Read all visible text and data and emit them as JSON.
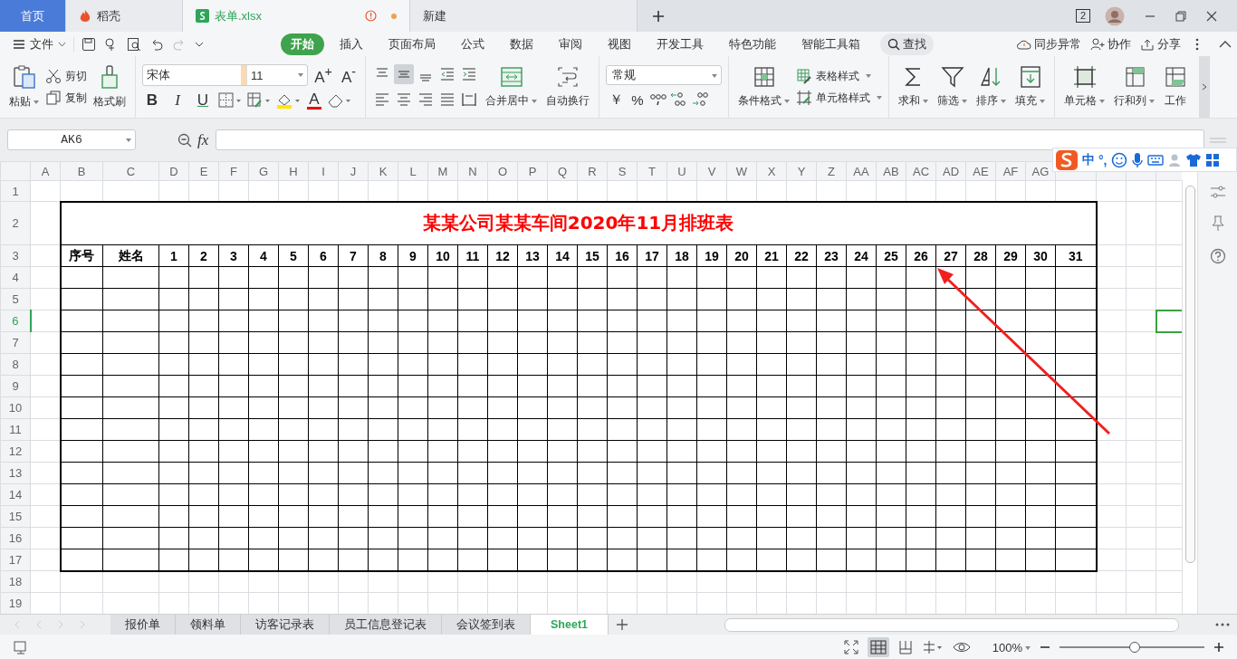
{
  "app_tabs": [
    {
      "kind": "home",
      "label": "首页",
      "selected": false,
      "unsaved": false
    },
    {
      "kind": "docer",
      "label": "稻壳",
      "selected": false,
      "unsaved": false
    },
    {
      "kind": "sheet",
      "label": "表单.xlsx",
      "selected": true,
      "unsaved": true
    },
    {
      "kind": "blank",
      "label": "新建",
      "selected": false,
      "unsaved": false
    }
  ],
  "window_count": "2",
  "menu": {
    "file": "文件",
    "tabs": [
      {
        "label": "开始",
        "selected": true
      },
      {
        "label": "插入",
        "selected": false
      },
      {
        "label": "页面布局",
        "selected": false
      },
      {
        "label": "公式",
        "selected": false
      },
      {
        "label": "数据",
        "selected": false
      },
      {
        "label": "审阅",
        "selected": false
      },
      {
        "label": "视图",
        "selected": false
      },
      {
        "label": "开发工具",
        "selected": false
      },
      {
        "label": "特色功能",
        "selected": false
      },
      {
        "label": "智能工具箱",
        "selected": false
      }
    ],
    "search": "查找",
    "actions": [
      {
        "kind": "sync",
        "label": "同步异常"
      },
      {
        "kind": "collab",
        "label": "协作"
      },
      {
        "kind": "share",
        "label": "分享"
      }
    ]
  },
  "ribbon": {
    "paste": "粘贴",
    "cut": "剪切",
    "copy": "复制",
    "format_painter": "格式刷",
    "font_name": "宋体",
    "font_size": "11",
    "grow": "A$^{+}$",
    "shrink": "A$^{-}$",
    "bold": "B",
    "italic": "I",
    "underline": "U",
    "font_color": "A",
    "merge": "合并居中",
    "wrap": "自动换行",
    "number_format": "常规",
    "currency": "￥",
    "percent": "%",
    "conditional": "条件格式",
    "table_style": "表格样式",
    "cell_style": "单元格样式",
    "editing": [
      {
        "kind": "sum",
        "label": "求和"
      },
      {
        "kind": "filter",
        "label": "筛选"
      },
      {
        "kind": "sort",
        "label": "排序"
      },
      {
        "kind": "fill",
        "label": "填充"
      }
    ],
    "cells": [
      {
        "kind": "cell",
        "label": "单元格"
      },
      {
        "kind": "rowcol",
        "label": "行和列"
      },
      {
        "kind": "sheet",
        "label": "工作"
      }
    ]
  },
  "formula_bar": {
    "name_box": "AK6",
    "fx": "fx"
  },
  "ime_bar": {
    "mode": "中",
    "punct": "°,"
  },
  "sheet": {
    "columns": [
      "A",
      "B",
      "C",
      "D",
      "E",
      "F",
      "G",
      "H",
      "I",
      "J",
      "K",
      "L",
      "M",
      "N",
      "O",
      "P",
      "Q",
      "R",
      "S",
      "T",
      "U",
      "V",
      "W",
      "X",
      "Y",
      "Z",
      "AA",
      "AB",
      "AC",
      "AD",
      "AE",
      "AF",
      "AG"
    ],
    "rows": [
      {
        "label": "1",
        "selected": false
      },
      {
        "label": "2",
        "selected": false
      },
      {
        "label": "3",
        "selected": false
      },
      {
        "label": "4",
        "selected": false
      },
      {
        "label": "5",
        "selected": false
      },
      {
        "label": "6",
        "selected": true
      },
      {
        "label": "7",
        "selected": false
      },
      {
        "label": "8",
        "selected": false
      },
      {
        "label": "9",
        "selected": false
      },
      {
        "label": "10",
        "selected": false
      },
      {
        "label": "11",
        "selected": false
      },
      {
        "label": "12",
        "selected": false
      },
      {
        "label": "13",
        "selected": false
      },
      {
        "label": "14",
        "selected": false
      },
      {
        "label": "15",
        "selected": false
      },
      {
        "label": "16",
        "selected": false
      },
      {
        "label": "17",
        "selected": false
      },
      {
        "label": "18",
        "selected": false
      },
      {
        "label": "19",
        "selected": false
      }
    ],
    "title": "某某公司某某车间2020年11月排班表",
    "headers": [
      "序号",
      "姓名",
      "1",
      "2",
      "3",
      "4",
      "5",
      "6",
      "7",
      "8",
      "9",
      "10",
      "11",
      "12",
      "13",
      "14",
      "15",
      "16",
      "17",
      "18",
      "19",
      "20",
      "21",
      "22",
      "23",
      "24",
      "25",
      "26",
      "27",
      "28",
      "29",
      "30",
      "31"
    ]
  },
  "sheet_tabs": [
    {
      "label": "报价单",
      "selected": false
    },
    {
      "label": "领料单",
      "selected": false
    },
    {
      "label": "访客记录表",
      "selected": false
    },
    {
      "label": "员工信息登记表",
      "selected": false
    },
    {
      "label": "会议签到表",
      "selected": false
    },
    {
      "label": "Sheet1",
      "selected": true
    }
  ],
  "status_bar": {
    "zoom": "100%",
    "zoom_slider": {
      "level": 0.52
    }
  }
}
